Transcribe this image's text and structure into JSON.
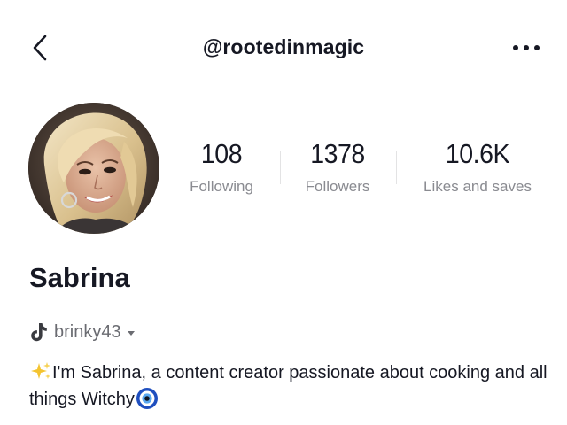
{
  "header": {
    "username": "@rootedinmagic"
  },
  "stats": {
    "following": {
      "value": "108",
      "label": "Following"
    },
    "followers": {
      "value": "1378",
      "label": "Followers"
    },
    "likes": {
      "value": "10.6K",
      "label": "Likes and saves"
    }
  },
  "profile": {
    "display_name": "Sabrina",
    "linked_account": "brinky43",
    "bio_text": "I'm Sabrina, a content creator passionate about cooking and all things Witchy",
    "bio_lead_emoji": "sparkles-icon",
    "bio_trail_emoji": "nazar-amulet-icon"
  },
  "icons": {
    "back": "chevron-left-icon",
    "more": "more-horizontal-icon",
    "linked_platform": "tiktok-icon"
  },
  "colors": {
    "text": "#161823",
    "secondary": "#8a8b91",
    "divider": "#e3e3e4"
  }
}
